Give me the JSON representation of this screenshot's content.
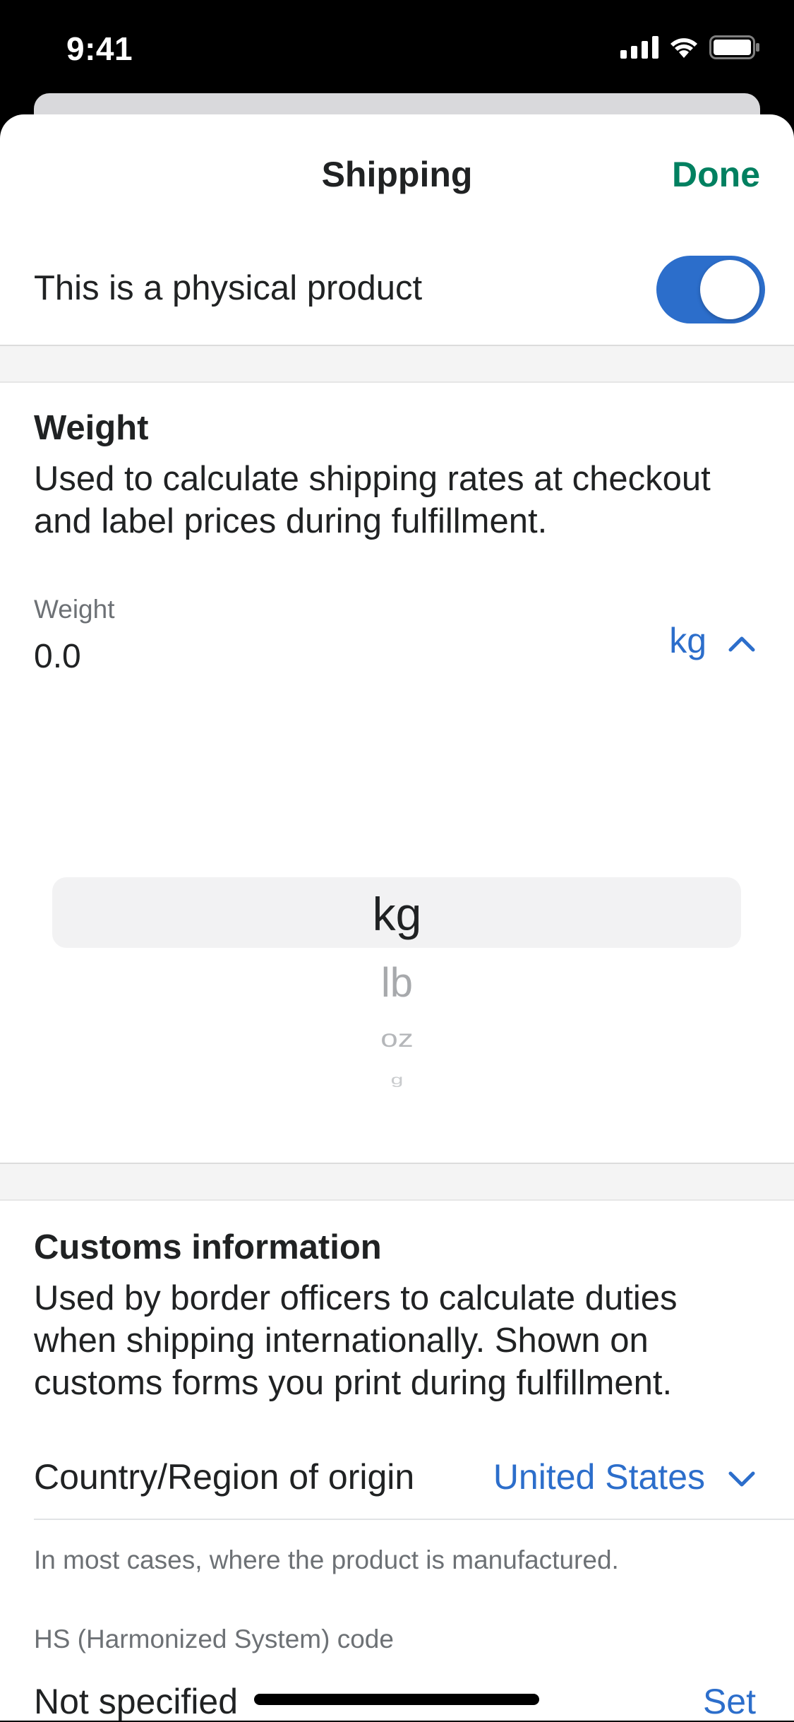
{
  "status_bar": {
    "time": "9:41"
  },
  "nav": {
    "title": "Shipping",
    "done_label": "Done"
  },
  "physical_product": {
    "label": "This is a physical product",
    "enabled": true
  },
  "weight_section": {
    "title": "Weight",
    "description": "Used to calculate shipping rates at checkout and label prices during fulfillment.",
    "field_label": "Weight",
    "field_value": "0.0",
    "unit": "kg",
    "unit_options": [
      "kg",
      "lb",
      "oz",
      "g"
    ]
  },
  "customs_section": {
    "title": "Customs information",
    "description": "Used by border officers to calculate duties when shipping internationally. Shown on customs forms you print during fulfillment.",
    "country_label": "Country/Region of origin",
    "country_value": "United States",
    "country_help": "In most cases, where the product is manufactured.",
    "hs_label": "HS (Harmonized System) code",
    "hs_value": "Not specified",
    "hs_action": "Set"
  },
  "colors": {
    "accent_blue": "#2c6ecb",
    "done_green": "#008060",
    "text": "#202223",
    "muted": "#6d7175"
  },
  "icons": [
    "signal-icon",
    "wifi-icon",
    "battery-icon",
    "chevron-up-icon",
    "chevron-down-icon"
  ]
}
